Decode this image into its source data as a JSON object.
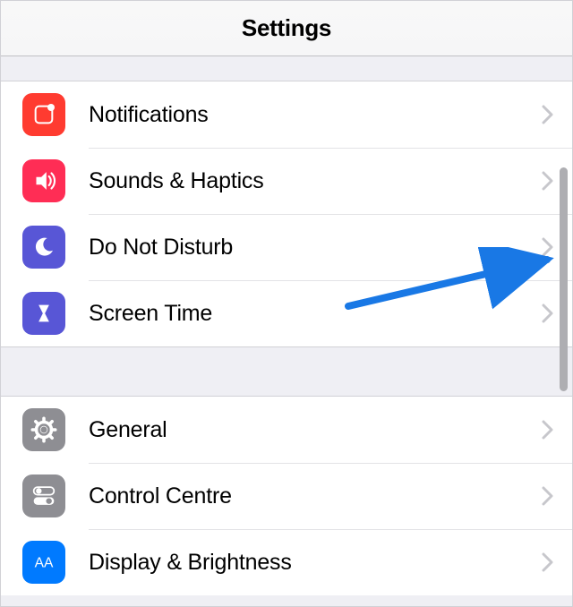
{
  "header": {
    "title": "Settings"
  },
  "group1": {
    "items": [
      {
        "icon": "notifications-icon",
        "label": "Notifications",
        "color": "bg-red"
      },
      {
        "icon": "sounds-icon",
        "label": "Sounds & Haptics",
        "color": "bg-pink"
      },
      {
        "icon": "dnd-icon",
        "label": "Do Not Disturb",
        "color": "bg-purple"
      },
      {
        "icon": "screentime-icon",
        "label": "Screen Time",
        "color": "bg-purple"
      }
    ]
  },
  "group2": {
    "items": [
      {
        "icon": "general-icon",
        "label": "General",
        "color": "bg-gray"
      },
      {
        "icon": "controlcentre-icon",
        "label": "Control Centre",
        "color": "bg-gray"
      },
      {
        "icon": "display-icon",
        "label": "Display & Brightness",
        "color": "bg-blue"
      }
    ]
  }
}
